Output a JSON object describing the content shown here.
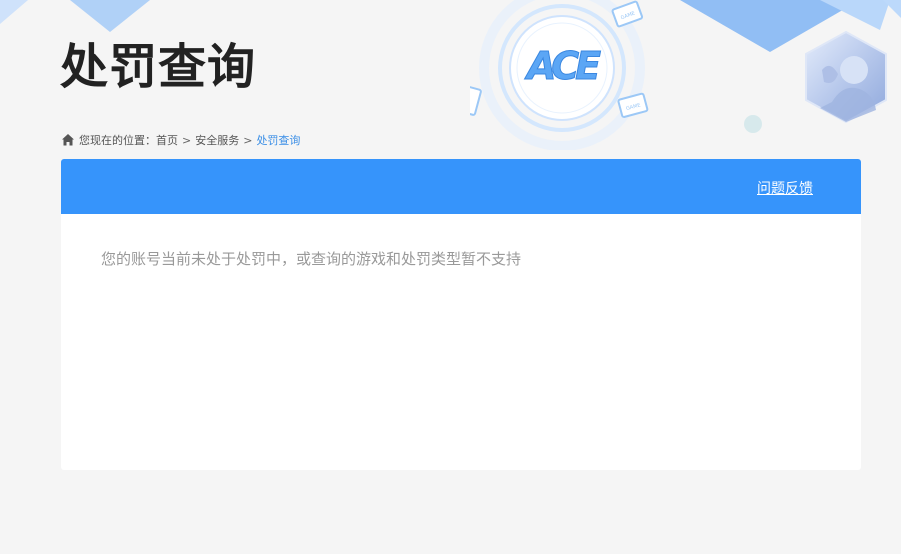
{
  "page": {
    "title": "处罚查询"
  },
  "breadcrumb": {
    "prefix": "您现在的位置：",
    "items": [
      "首页",
      "安全服务"
    ],
    "current": "处罚查询",
    "separator": ">"
  },
  "panel": {
    "feedback_link": "问题反馈",
    "message": "您的账号当前未处于处罚中，或查询的游戏和处罚类型暂不支持"
  },
  "logo": {
    "text": "ACE",
    "badge_text": "GAME"
  },
  "colors": {
    "header_bar": "#3694fb",
    "breadcrumb_current": "#3a8ee6",
    "title": "#222222",
    "message": "#999999",
    "background": "#f5f5f5"
  },
  "icons": {
    "breadcrumb_home": "home-icon"
  }
}
